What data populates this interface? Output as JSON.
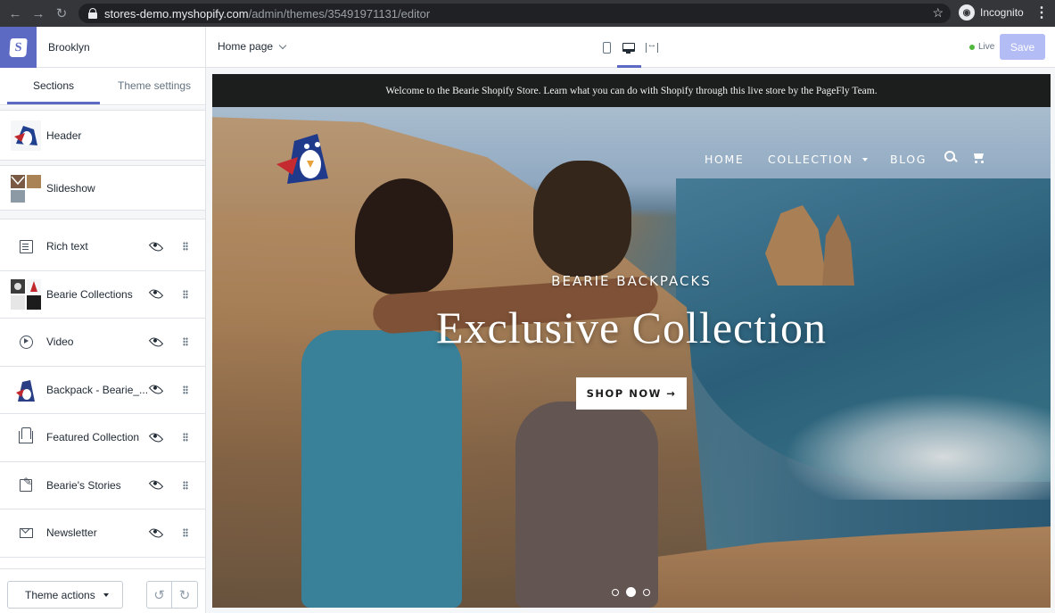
{
  "browser": {
    "url_host": "stores-demo.myshopify.com",
    "url_path": "/admin/themes/35491971131/editor",
    "profile": "Incognito"
  },
  "editor": {
    "theme_name": "Brooklyn",
    "page_selector": "Home page",
    "status": "Live",
    "save_label": "Save",
    "active_device": "desktop",
    "accent_color": "#5c6ac4"
  },
  "sidebar": {
    "tabs": [
      {
        "label": "Sections",
        "active": true
      },
      {
        "label": "Theme settings",
        "active": false
      }
    ],
    "fixed_sections": [
      {
        "label": "Header",
        "icon": "header-thumbnail"
      },
      {
        "label": "Slideshow",
        "icon": "slideshow-thumbnail"
      }
    ],
    "sections": [
      {
        "label": "Rich text",
        "icon": "rich-text-icon"
      },
      {
        "label": "Bearie Collections",
        "icon": "collection-thumbnail"
      },
      {
        "label": "Video",
        "icon": "video-icon"
      },
      {
        "label": "Backpack - Bearie_...",
        "icon": "product-thumbnail"
      },
      {
        "label": "Featured Collection",
        "icon": "featured-collection-icon"
      },
      {
        "label": "Bearie's Stories",
        "icon": "blog-icon"
      },
      {
        "label": "Newsletter",
        "icon": "newsletter-icon"
      }
    ],
    "theme_actions_label": "Theme actions"
  },
  "preview": {
    "announcement": "Welcome to the Bearie Shopify Store. Learn what you can do with Shopify through this live store by the PageFly Team.",
    "nav": {
      "home": "HOME",
      "collection": "COLLECTION",
      "blog": "BLOG"
    },
    "hero": {
      "subtitle": "BEARIE BACKPACKS",
      "title": "Exclusive Collection",
      "button": "SHOP NOW →",
      "active_slide": 2,
      "slide_count": 3
    }
  }
}
